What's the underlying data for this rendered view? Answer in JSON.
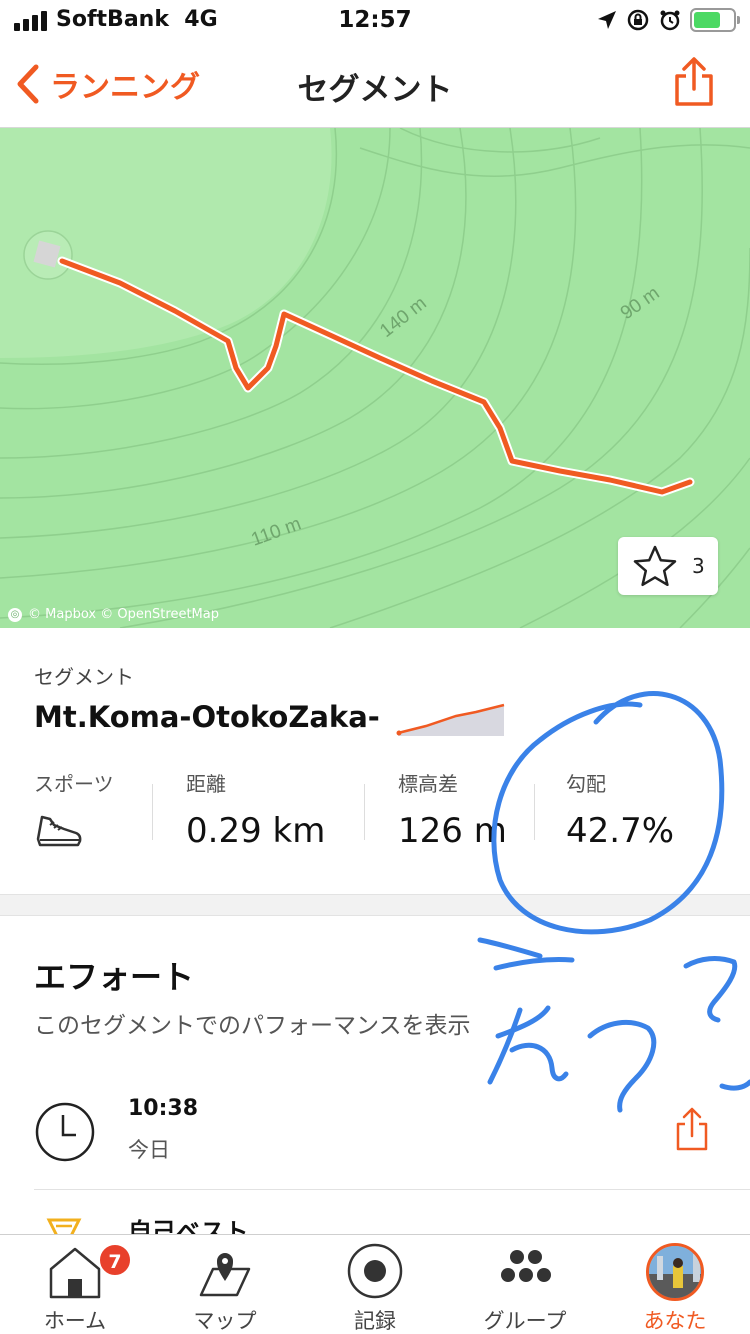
{
  "status_bar": {
    "carrier": "SoftBank",
    "network": "4G",
    "time": "12:57"
  },
  "nav": {
    "back_label": "ランニング",
    "title": "セグメント"
  },
  "map": {
    "contour_labels": [
      "140 m",
      "90 m",
      "110 m"
    ],
    "attribution": "© Mapbox © OpenStreetMap",
    "star_count": "3",
    "route_color": "#f05a22",
    "map_color": "#a3e4a1"
  },
  "segment": {
    "label": "セグメント",
    "name": "Mt.Koma-OtokoZaka-",
    "stats": [
      {
        "label": "スポーツ",
        "value": ""
      },
      {
        "label": "距離",
        "value": "0.29 km"
      },
      {
        "label": "標高差",
        "value": "126 m"
      },
      {
        "label": "勾配",
        "value": "42.7%"
      }
    ]
  },
  "effort": {
    "title": "エフォート",
    "subtitle": "このセグメントでのパフォーマンスを表示",
    "time": "10:38",
    "day": "今日",
    "personal_best_label": "自己ベスト"
  },
  "tabs": [
    {
      "label": "ホーム",
      "icon": "home-icon",
      "badge": "7"
    },
    {
      "label": "マップ",
      "icon": "map-icon"
    },
    {
      "label": "記録",
      "icon": "record-icon"
    },
    {
      "label": "グループ",
      "icon": "group-icon"
    },
    {
      "label": "あなた",
      "icon": "avatar",
      "active": true
    }
  ],
  "accent_color": "#f05a22",
  "annotation_color": "#3a82e8"
}
